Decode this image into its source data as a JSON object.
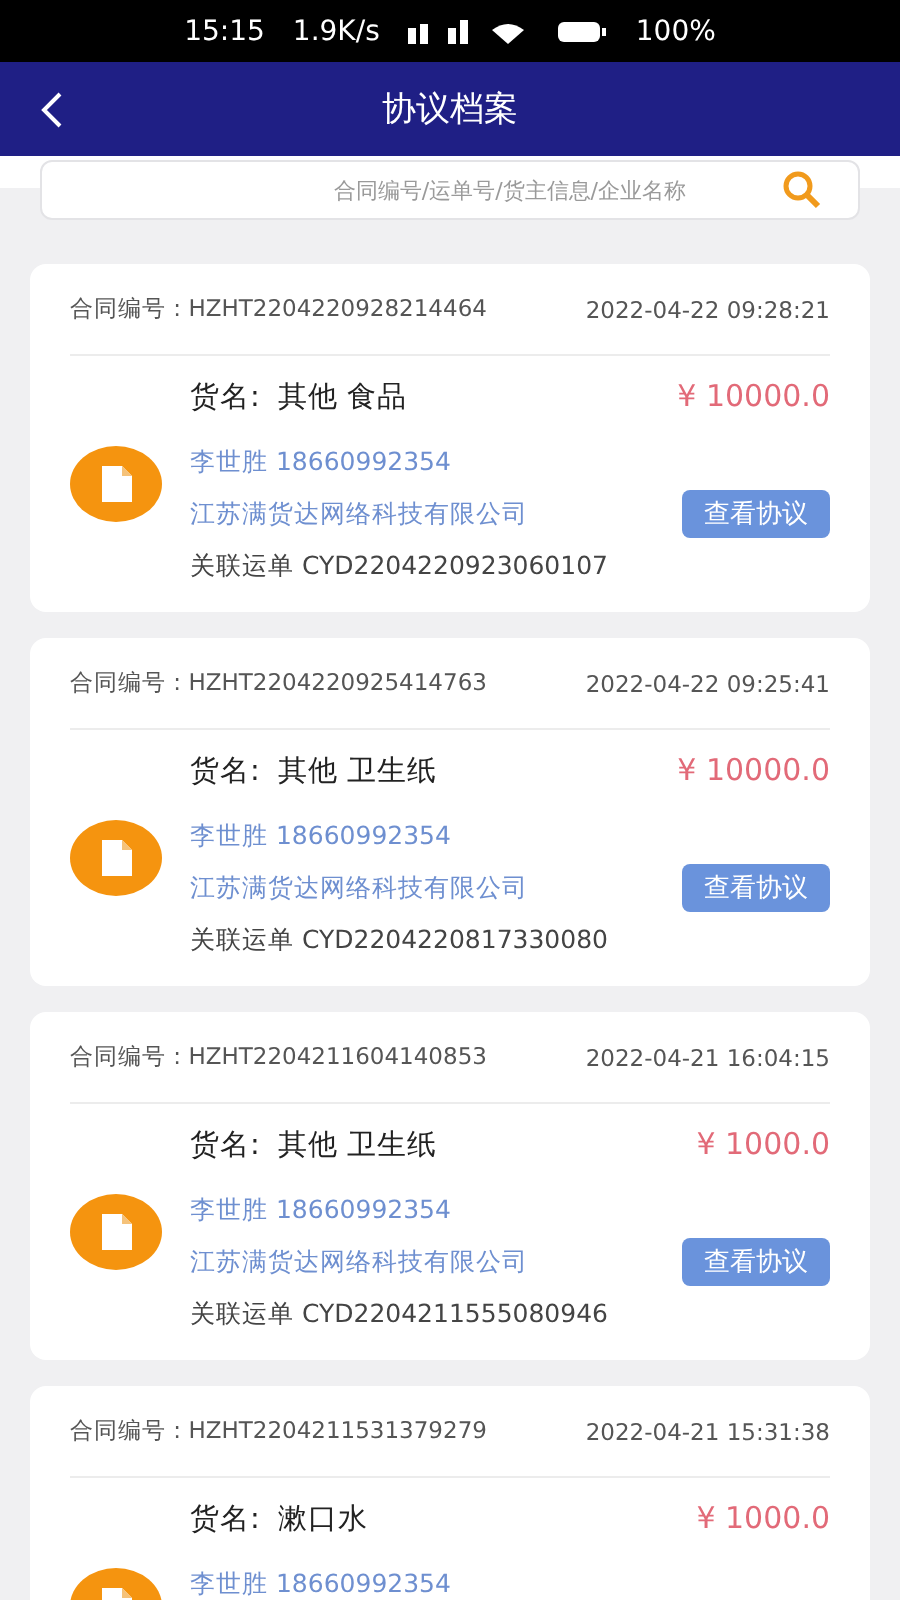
{
  "status_bar": {
    "time": "15:15",
    "speed": "1.9K/s",
    "battery": "100%"
  },
  "header": {
    "title": "协议档案"
  },
  "search": {
    "placeholder": "合同编号/运单号/货主信息/企业名称"
  },
  "contracts": [
    {
      "label": "合同编号 :",
      "number": "HZHT2204220928214464",
      "date": "2022-04-22 09:28:21",
      "goods_label": "货名:",
      "goods": "其他 食品",
      "price": "¥ 10000.0",
      "contact": "李世胜 18660992354",
      "company": "江苏满货达网络科技有限公司",
      "button": "查看协议",
      "waybill": "关联运单 CYD2204220923060107"
    },
    {
      "label": "合同编号 :",
      "number": "HZHT2204220925414763",
      "date": "2022-04-22 09:25:41",
      "goods_label": "货名:",
      "goods": "其他 卫生纸",
      "price": "¥ 10000.0",
      "contact": "李世胜 18660992354",
      "company": "江苏满货达网络科技有限公司",
      "button": "查看协议",
      "waybill": "关联运单 CYD2204220817330080"
    },
    {
      "label": "合同编号 :",
      "number": "HZHT2204211604140853",
      "date": "2022-04-21 16:04:15",
      "goods_label": "货名:",
      "goods": "其他 卫生纸",
      "price": "¥ 1000.0",
      "contact": "李世胜 18660992354",
      "company": "江苏满货达网络科技有限公司",
      "button": "查看协议",
      "waybill": "关联运单 CYD2204211555080946"
    },
    {
      "label": "合同编号 :",
      "number": "HZHT2204211531379279",
      "date": "2022-04-21 15:31:38",
      "goods_label": "货名:",
      "goods": "漱口水",
      "price": "¥ 1000.0",
      "contact": "李世胜 18660992354"
    }
  ]
}
